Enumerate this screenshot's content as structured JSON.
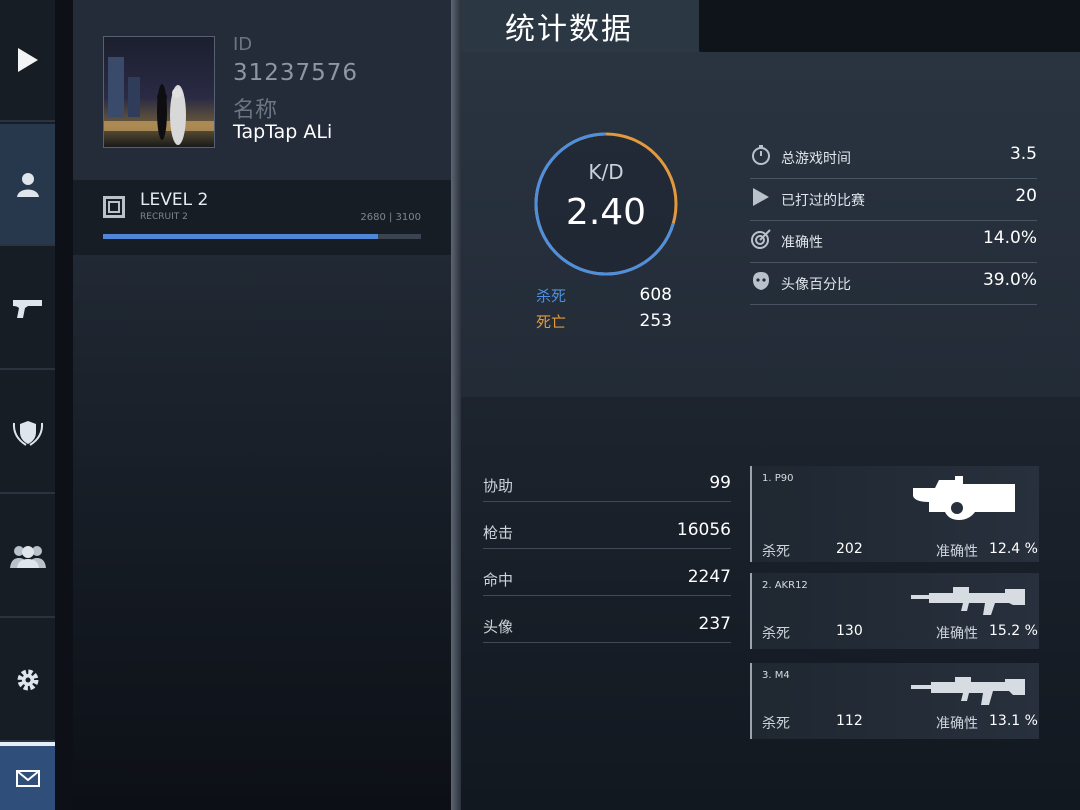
{
  "nav": {
    "items": [
      {
        "icon": "play-icon"
      },
      {
        "icon": "profile-icon",
        "active": true
      },
      {
        "icon": "pistol-icon"
      },
      {
        "icon": "emblem-icon"
      },
      {
        "icon": "squad-icon"
      },
      {
        "icon": "gear-icon"
      },
      {
        "icon": "mail-icon"
      }
    ]
  },
  "profile": {
    "id_label": "ID",
    "id_value": "31237576",
    "name_label": "名称",
    "name_value": "TapTap ALi",
    "level_title": "LEVEL 2",
    "level_sub": "RECRUIT 2",
    "xp_text": "2680 | 3100",
    "xp_progress": 0.865
  },
  "page_title": "统计数据",
  "kd": {
    "label": "K/D",
    "value": "2.40",
    "kills_label": "杀死",
    "kills_value": "608",
    "deaths_label": "死亡",
    "deaths_value": "253",
    "kills_color": "#4f8fe0",
    "deaths_color": "#e39a3c"
  },
  "stats": [
    {
      "icon": "stopwatch-icon",
      "label": "总游戏时间",
      "value": "3.5"
    },
    {
      "icon": "play-triangle-icon",
      "label": "已打过的比赛",
      "value": "20"
    },
    {
      "icon": "target-icon",
      "label": "准确性",
      "value": "14.0%"
    },
    {
      "icon": "head-icon",
      "label": "头像百分比",
      "value": "39.0%"
    }
  ],
  "misc": [
    {
      "label": "协助",
      "value": "99"
    },
    {
      "label": "枪击",
      "value": "16056"
    },
    {
      "label": "命中",
      "value": "2247"
    },
    {
      "label": "头像",
      "value": "237"
    }
  ],
  "weapons": [
    {
      "rank": "1. P90",
      "kills_label": "杀死",
      "kills": "202",
      "acc_label": "准确性",
      "acc": "12.4 %",
      "icon": "p90-icon"
    },
    {
      "rank": "2. AKR12",
      "kills_label": "杀死",
      "kills": "130",
      "acc_label": "准确性",
      "acc": "15.2 %",
      "icon": "akr12-icon"
    },
    {
      "rank": "3. M4",
      "kills_label": "杀死",
      "kills": "112",
      "acc_label": "准确性",
      "acc": "13.1 %",
      "icon": "m4-icon"
    }
  ]
}
